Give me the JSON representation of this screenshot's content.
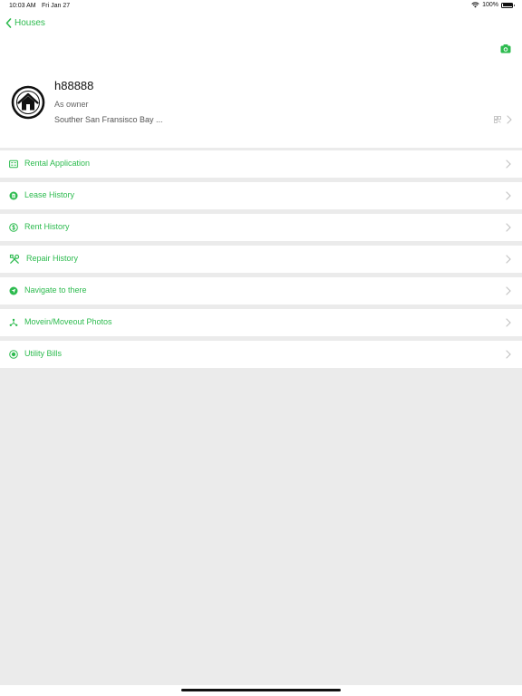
{
  "status_bar": {
    "time": "10:03 AM",
    "date": "Fri Jan 27",
    "battery": "100%"
  },
  "nav": {
    "back_label": "Houses"
  },
  "property": {
    "name": "h88888",
    "role": "As owner",
    "address": "Souther San Fransisco Bay  ..."
  },
  "menu": [
    {
      "label": "Rental Application",
      "icon": "application-icon"
    },
    {
      "label": "Lease History",
      "icon": "lease-icon"
    },
    {
      "label": "Rent History",
      "icon": "dollar-icon"
    },
    {
      "label": "Repair History",
      "icon": "tools-icon"
    },
    {
      "label": "Navigate to there",
      "icon": "navigate-icon"
    },
    {
      "label": "Movein/Moveout Photos",
      "icon": "photos-icon"
    },
    {
      "label": "Utility Bills",
      "icon": "utility-icon"
    }
  ],
  "colors": {
    "accent": "#2dbb4f",
    "background": "#ebebeb",
    "surface": "#ffffff"
  }
}
